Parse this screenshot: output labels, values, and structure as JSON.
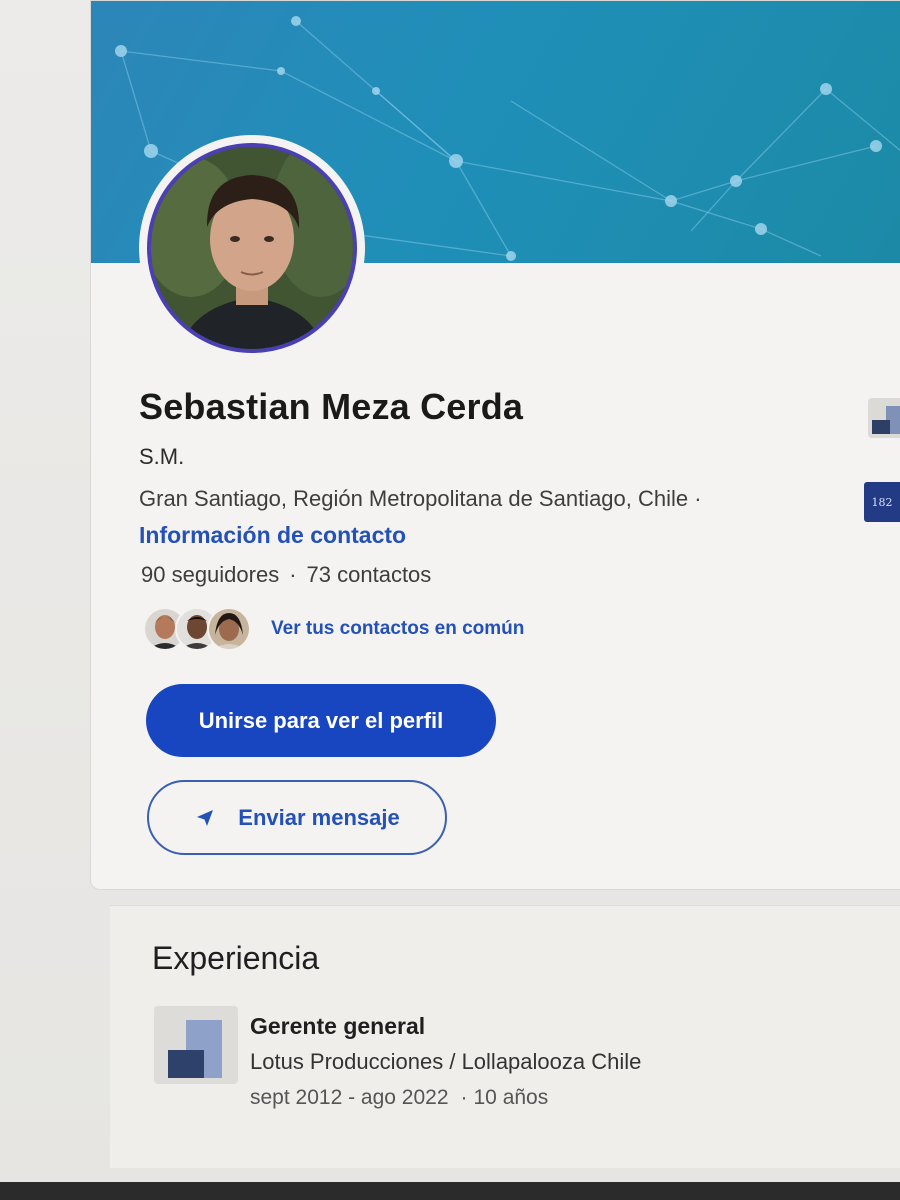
{
  "profile": {
    "name": "Sebastian Meza Cerda",
    "headline": "S.M.",
    "location": "Gran Santiago, Región Metropolitana de Santiago, Chile ·",
    "contact_info_label": "Información de contacto",
    "followers": "90 seguidores",
    "stats_separator": "·",
    "connections": "73 contactos",
    "mutual_connections_label": "Ver tus contactos en común"
  },
  "actions": {
    "join_label": "Unirse para ver el perfil",
    "message_label": "Enviar mensaje",
    "message_icon": "send-icon"
  },
  "side_logos": {
    "second_logo_text": "182"
  },
  "experience": {
    "section_title": "Experiencia",
    "items": [
      {
        "role": "Gerente general",
        "company": "Lotus Producciones / Lollapalooza Chile",
        "date_range": "sept 2012 - ago 2022",
        "duration": "10 años"
      }
    ]
  },
  "colors": {
    "primary_button": "#1845c0",
    "link": "#2451b8",
    "banner": "#1f8fb8",
    "avatar_ring": "#4a3fb3"
  }
}
